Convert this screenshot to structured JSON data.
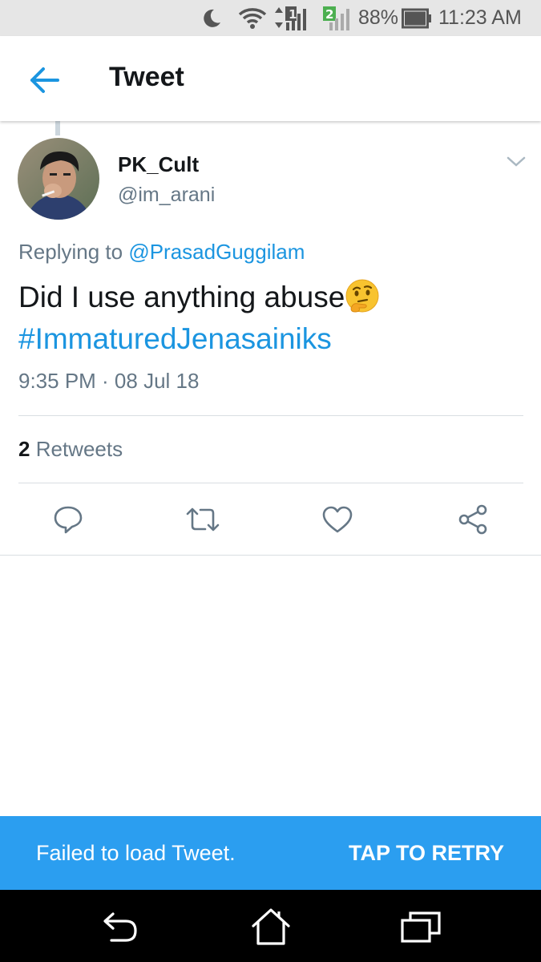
{
  "status_bar": {
    "battery": "88%",
    "time": "11:23 AM",
    "sim2_badge": "2",
    "signal1_badge": "1",
    "icons": [
      "moon-icon",
      "wifi-icon",
      "signal-icon",
      "signal-icon",
      "battery-icon"
    ]
  },
  "header": {
    "title": "Tweet",
    "back_icon": "arrow-left-icon"
  },
  "tweet": {
    "author_name": "PK_Cult",
    "author_handle": "@im_arani",
    "replying_prefix": "Replying to",
    "replying_to": "@PrasadGuggilam",
    "text": "Did I use anything abuse",
    "emoji": "thinking-face-emoji",
    "hashtag": "#ImmaturedJenasainiks",
    "timestamp": "9:35 PM · 08 Jul 18",
    "retweet_count": "2",
    "retweet_label": "Retweets"
  },
  "actions": [
    "reply-icon",
    "retweet-icon",
    "like-icon",
    "share-icon"
  ],
  "snackbar": {
    "message": "Failed to load Tweet.",
    "action": "TAP TO RETRY"
  },
  "nav": [
    "back-icon",
    "home-icon",
    "recents-icon"
  ],
  "colors": {
    "accent": "#1b95e0",
    "snackbar": "#2b9ef0",
    "text": "#14171a",
    "secondary": "#657786"
  }
}
